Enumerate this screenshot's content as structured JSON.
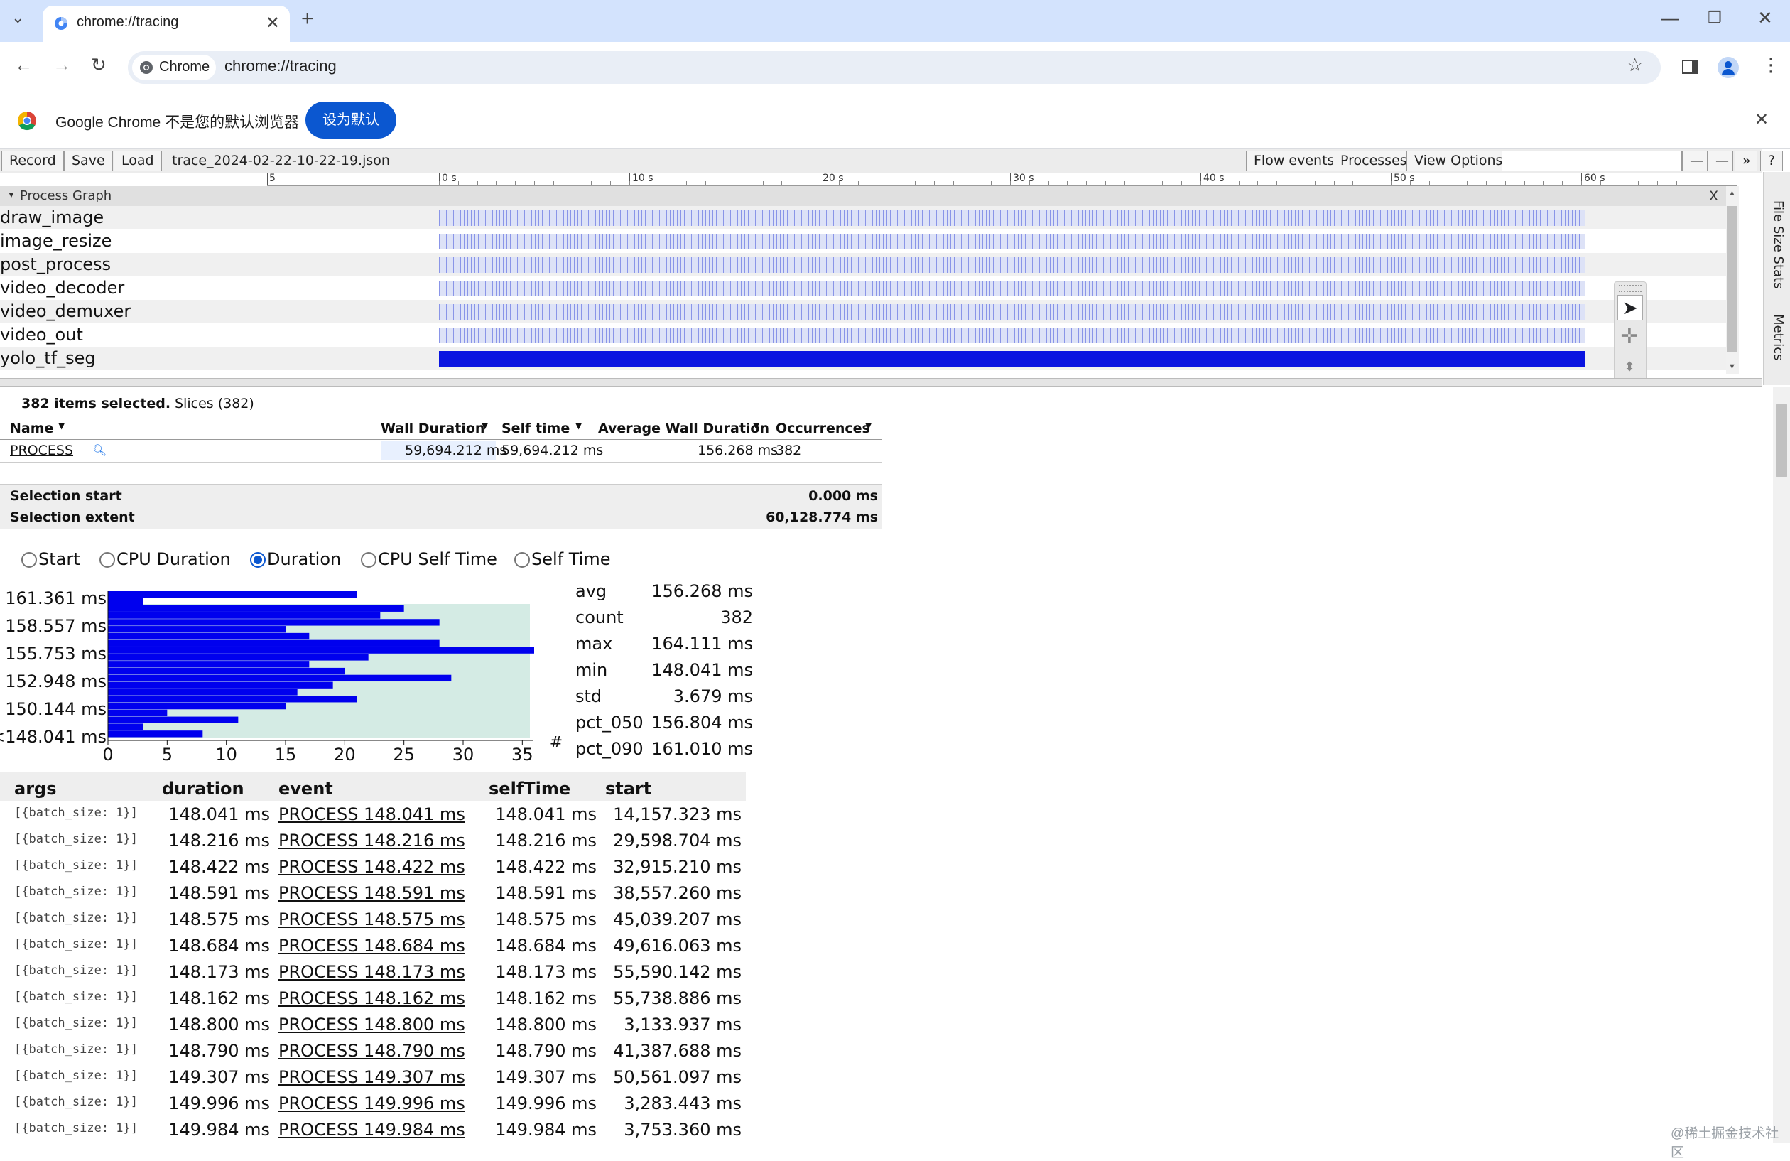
{
  "browser": {
    "tab_title": "chrome://tracing",
    "chip_label": "Chrome",
    "url": "chrome://tracing",
    "infobar_text": "Google Chrome 不是您的默认浏览器",
    "infobar_button": "设为默认"
  },
  "toolbar": {
    "record": "Record",
    "save": "Save",
    "load": "Load",
    "filename": "trace_2024-02-22-10-22-19.json",
    "flow_events": "Flow events",
    "processes": "Processes",
    "view_options": "View Options",
    "zoom_out": "—",
    "zoom_in": "—",
    "more": "»",
    "help": "?"
  },
  "ruler": {
    "labels": [
      "5",
      "0 s",
      "10 s",
      "20 s",
      "30 s",
      "40 s",
      "50 s",
      "60 s"
    ]
  },
  "process_graph": {
    "header": "Process Graph",
    "close": "X",
    "tracks": [
      "draw_image",
      "image_resize",
      "post_process",
      "video_decoder",
      "video_demuxer",
      "video_out",
      "yolo_tf_seg"
    ]
  },
  "sidebar": {
    "file_size_stats": "File Size Stats",
    "metrics": "Metrics"
  },
  "selection": {
    "summary": "382 items selected.",
    "tab": "Slices (382)",
    "columns": [
      "Name",
      "Wall Duration",
      "Self time",
      "Average Wall Duration",
      "Occurrences"
    ],
    "row": {
      "name": "PROCESS",
      "wall": "59,694.212 ms",
      "self": "59,694.212 ms",
      "avg": "156.268 ms",
      "occ": "382"
    },
    "selection_start_label": "Selection start",
    "selection_start": "0.000 ms",
    "selection_extent_label": "Selection extent",
    "selection_extent": "60,128.774 ms"
  },
  "radios": [
    "Start",
    "CPU Duration",
    "Duration",
    "CPU Self Time",
    "Self Time"
  ],
  "chart_data": {
    "type": "bar",
    "orientation": "horizontal",
    "title": "",
    "xlabel": "#",
    "ylabel": "",
    "xlim": [
      0,
      36
    ],
    "xticks": [
      "0",
      "5",
      "10",
      "15",
      "20",
      "25",
      "30",
      "35"
    ],
    "ytick_labels": [
      "161.361 ms",
      "158.557 ms",
      "155.753 ms",
      "152.948 ms",
      "150.144 ms",
      "<148.041 ms"
    ],
    "values": [
      21,
      3,
      25,
      23,
      28,
      15,
      17,
      28,
      36,
      22,
      17,
      20,
      29,
      19,
      16,
      21,
      15,
      5,
      11,
      3,
      8
    ],
    "bar_color": "#0000ee",
    "background_color": "#d4ebe4"
  },
  "stats": [
    {
      "label": "avg",
      "value": "156.268 ms"
    },
    {
      "label": "count",
      "value": "382"
    },
    {
      "label": "max",
      "value": "164.111 ms"
    },
    {
      "label": "min",
      "value": "148.041 ms"
    },
    {
      "label": "std",
      "value": "3.679 ms"
    },
    {
      "label": "pct_050",
      "value": "156.804 ms"
    },
    {
      "label": "pct_090",
      "value": "161.010 ms"
    }
  ],
  "events": {
    "columns": [
      "args",
      "duration",
      "event",
      "selfTime",
      "start"
    ],
    "rows": [
      {
        "args": "[{batch_size: 1}]",
        "duration": "148.041 ms",
        "event": "PROCESS 148.041 ms",
        "self": "148.041 ms",
        "start": "14,157.323 ms"
      },
      {
        "args": "[{batch_size: 1}]",
        "duration": "148.216 ms",
        "event": "PROCESS 148.216 ms",
        "self": "148.216 ms",
        "start": "29,598.704 ms"
      },
      {
        "args": "[{batch_size: 1}]",
        "duration": "148.422 ms",
        "event": "PROCESS 148.422 ms",
        "self": "148.422 ms",
        "start": "32,915.210 ms"
      },
      {
        "args": "[{batch_size: 1}]",
        "duration": "148.591 ms",
        "event": "PROCESS 148.591 ms",
        "self": "148.591 ms",
        "start": "38,557.260 ms"
      },
      {
        "args": "[{batch_size: 1}]",
        "duration": "148.575 ms",
        "event": "PROCESS 148.575 ms",
        "self": "148.575 ms",
        "start": "45,039.207 ms"
      },
      {
        "args": "[{batch_size: 1}]",
        "duration": "148.684 ms",
        "event": "PROCESS 148.684 ms",
        "self": "148.684 ms",
        "start": "49,616.063 ms"
      },
      {
        "args": "[{batch_size: 1}]",
        "duration": "148.173 ms",
        "event": "PROCESS 148.173 ms",
        "self": "148.173 ms",
        "start": "55,590.142 ms"
      },
      {
        "args": "[{batch_size: 1}]",
        "duration": "148.162 ms",
        "event": "PROCESS 148.162 ms",
        "self": "148.162 ms",
        "start": "55,738.886 ms"
      },
      {
        "args": "[{batch_size: 1}]",
        "duration": "148.800 ms",
        "event": "PROCESS 148.800 ms",
        "self": "148.800 ms",
        "start": "3,133.937 ms"
      },
      {
        "args": "[{batch_size: 1}]",
        "duration": "148.790 ms",
        "event": "PROCESS 148.790 ms",
        "self": "148.790 ms",
        "start": "41,387.688 ms"
      },
      {
        "args": "[{batch_size: 1}]",
        "duration": "149.307 ms",
        "event": "PROCESS 149.307 ms",
        "self": "149.307 ms",
        "start": "50,561.097 ms"
      },
      {
        "args": "[{batch_size: 1}]",
        "duration": "149.996 ms",
        "event": "PROCESS 149.996 ms",
        "self": "149.996 ms",
        "start": "3,283.443 ms"
      },
      {
        "args": "[{batch_size: 1}]",
        "duration": "149.984 ms",
        "event": "PROCESS 149.984 ms",
        "self": "149.984 ms",
        "start": "3,753.360 ms"
      }
    ]
  },
  "watermark": "@稀土掘金技术社区"
}
